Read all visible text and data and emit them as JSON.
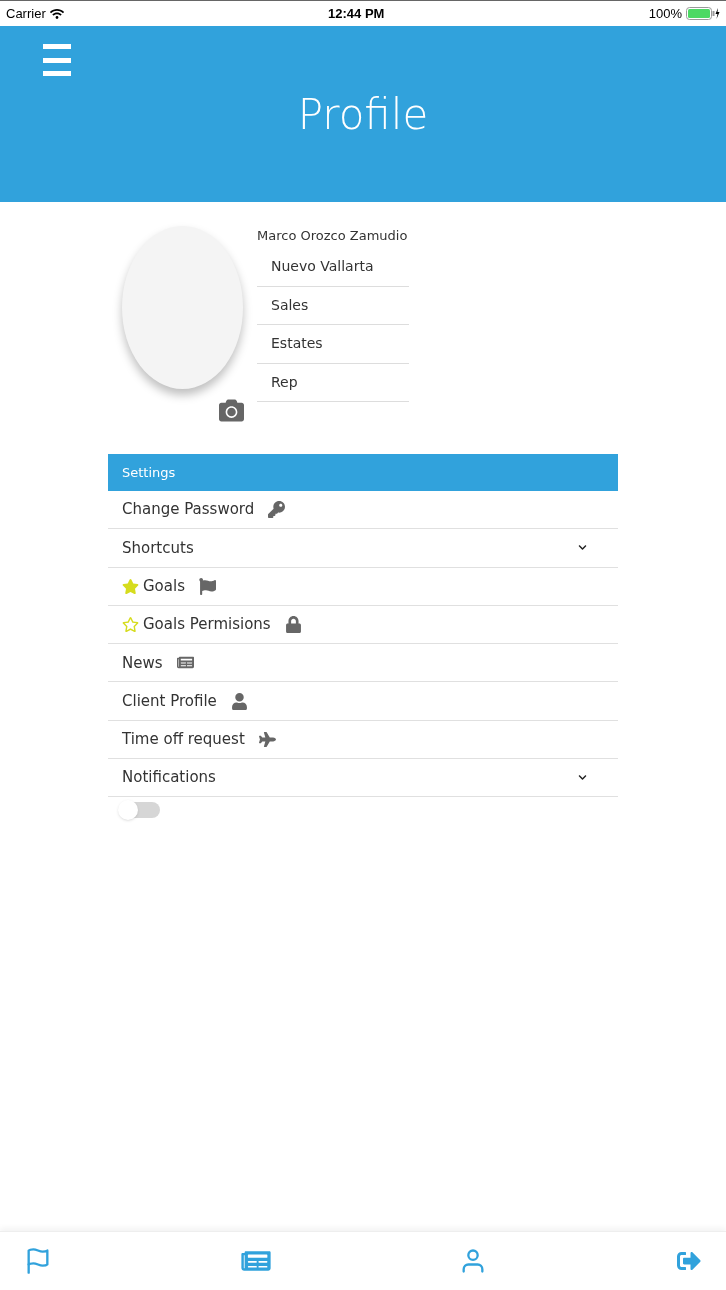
{
  "status_bar": {
    "carrier": "Carrier",
    "time": "12:44 PM",
    "battery": "100%"
  },
  "header": {
    "title": "Profile"
  },
  "profile": {
    "name": "Marco Orozco Zamudio",
    "details": [
      "Nuevo Vallarta",
      "Sales",
      "Estates",
      "Rep"
    ]
  },
  "settings": {
    "title": "Settings",
    "items": [
      {
        "kind": "link",
        "label": "Change Password"
      },
      {
        "kind": "dropdown",
        "label": "Shortcuts",
        "expanded": false
      },
      {
        "kind": "star-link",
        "label": "Goals",
        "starred": true
      },
      {
        "kind": "star-link",
        "label": "Goals Permisions",
        "starred": false
      },
      {
        "kind": "link",
        "label": "News"
      },
      {
        "kind": "link",
        "label": "Client Profile"
      },
      {
        "kind": "link",
        "label": "Time off request"
      },
      {
        "kind": "dropdown",
        "label": "Notifications",
        "expanded": false
      }
    ],
    "notifications_toggle": {
      "on": false
    }
  }
}
